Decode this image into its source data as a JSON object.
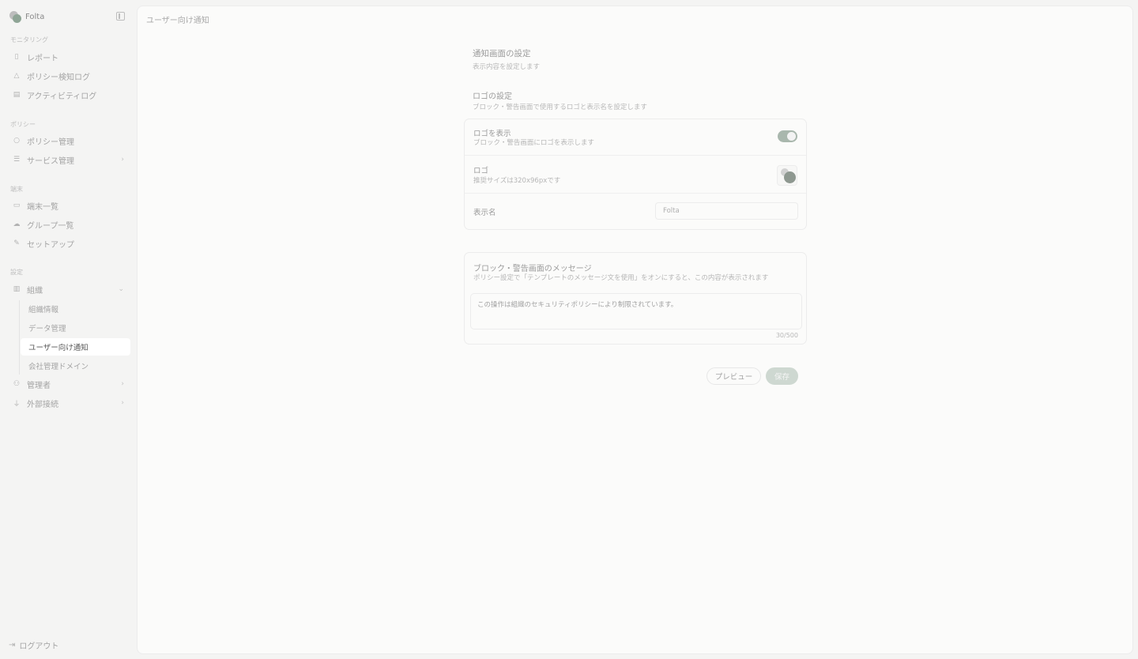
{
  "app": {
    "name": "Folta"
  },
  "sidebar": {
    "collapse_icon": "sidebar-toggle-icon",
    "sections": {
      "monitoring": "モニタリング",
      "policy": "ポリシー",
      "devices": "端末",
      "settings": "設定"
    },
    "items": {
      "reports": "レポート",
      "policy_logs": "ポリシー検知ログ",
      "activity_logs": "アクティビティログ",
      "policy_management": "ポリシー管理",
      "service_management": "サービス管理",
      "device_list": "端末一覧",
      "group_list": "グループ一覧",
      "setup": "セットアップ",
      "organization": "組織",
      "administrators": "管理者",
      "external_connections": "外部接続"
    },
    "sub_items": {
      "org_info": "組織情報",
      "data_management": "データ管理",
      "user_notification": "ユーザー向け通知",
      "company_domains": "会社管理ドメイン"
    },
    "logout": "ログアウト"
  },
  "breadcrumb": "ユーザー向け通知",
  "page": {
    "title": "通知画面の設定",
    "subtitle": "表示内容を設定します",
    "logo_section": {
      "title": "ロゴの設定",
      "description": "ブロック・警告画面で使用するロゴと表示名を設定します",
      "show_logo": {
        "title": "ロゴを表示",
        "description": "ブロック・警告画面にロゴを表示します",
        "enabled": true
      },
      "logo": {
        "title": "ロゴ",
        "description": "推奨サイズは320x96pxです"
      },
      "display_name": {
        "label": "表示名",
        "value": "Folta"
      }
    },
    "message_section": {
      "title": "ブロック・警告画面のメッセージ",
      "description": "ポリシー設定で「テンプレートのメッセージ文を使用」をオンにすると、この内容が表示されます",
      "message": "この操作は組織のセキュリティポリシーにより制限されています。",
      "counter": "30/500"
    },
    "buttons": {
      "preview": "プレビュー",
      "save": "保存"
    }
  },
  "colors": {
    "accent": "#a9b7ad",
    "save_button": "#ced8d1",
    "active_nav_bg": "#ffffff"
  }
}
